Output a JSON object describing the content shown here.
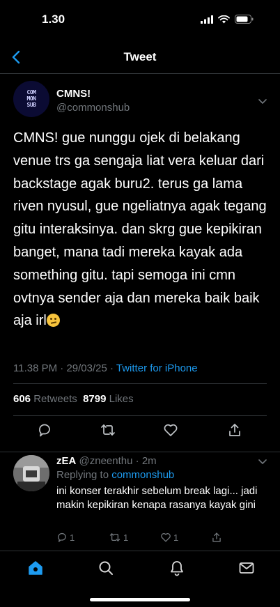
{
  "status": {
    "time": "1.30"
  },
  "nav": {
    "title": "Tweet"
  },
  "tweet": {
    "author_name": "CMNS!",
    "author_handle": "@commonshub",
    "avatar_text": [
      "COM",
      "MON",
      "SUB"
    ],
    "text": "CMNS! gue nunggu ojek di belakang venue trs ga sengaja liat vera keluar dari backstage agak buru2. terus ga lama riven nyusul, gue ngeliatnya agak tegang gitu interaksinya. dan skrg gue kepikiran banget, mana tadi mereka kayak ada something gitu. tapi semoga ini cmn ovtnya sender aja dan mereka baik baik aja irl",
    "time": "11.38 PM",
    "date": "29/03/25",
    "source": "Twitter for iPhone",
    "retweets_count": "606",
    "retweets_label": "Retweets",
    "likes_count": "8799",
    "likes_label": "Likes"
  },
  "reply": {
    "name": "zEA",
    "handle": "@zneenthu",
    "time": "2m",
    "replying_label": "Replying to",
    "replying_to": "commonshub",
    "text": "ini konser terakhir sebelum break lagi... jadi makin kepikiran kenapa rasanya kayak gini",
    "reply_count": "1",
    "retweet_count": "1",
    "like_count": "1"
  },
  "tabs": [
    "home-icon",
    "search-icon",
    "notifications-icon",
    "messages-icon"
  ],
  "colors": {
    "accent": "#1d9bf0",
    "muted": "#71767b",
    "divider": "#2f3336"
  }
}
